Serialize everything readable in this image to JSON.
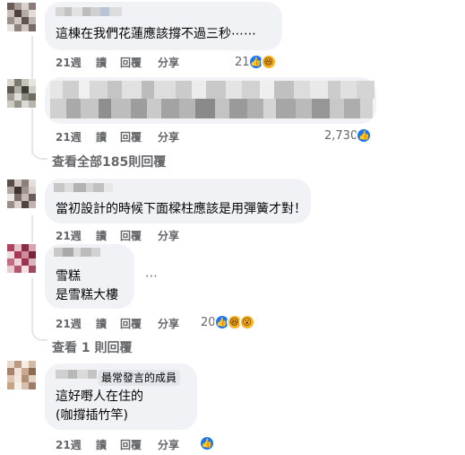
{
  "colors": {
    "like": "#1877f2",
    "laugh": "#f7b125",
    "muted_text": "#65676b",
    "bubble": "#f0f2f5"
  },
  "comments": [
    {
      "text_lines": [
        "這棟在我們花蓮應該撐不過三秒⋯⋯"
      ],
      "time": "21週",
      "read": "讀",
      "reply": "回覆",
      "share": "分享",
      "reaction_count": "21",
      "reaction_icons": [
        "like-icon",
        "laugh-icon"
      ]
    },
    {
      "text_lines": [],
      "time": "21週",
      "read": "讀",
      "reply": "回覆",
      "share": "分享",
      "reaction_count": "2,730",
      "reaction_icons": [
        "like-icon"
      ]
    },
    {
      "text_lines": [
        "當初設計的時候下面樑柱應該是用彈簧才對！"
      ],
      "time": "21週",
      "read": "讀",
      "reply": "回覆",
      "share": "分享",
      "reaction_count": "",
      "reaction_icons": []
    },
    {
      "text_lines": [
        "雪糕",
        "是雪糕大樓"
      ],
      "time": "21週",
      "read": "讀",
      "reply": "回覆",
      "share": "分享",
      "reaction_count": "20",
      "reaction_icons": [
        "like-icon",
        "laugh-icon",
        "wow-icon"
      ],
      "more": "⋯"
    },
    {
      "badge": "最常發言的成員",
      "text_lines": [
        "這好嘢人在住的",
        "(咖撐插竹竿)"
      ],
      "time": "21週",
      "read": "讀",
      "reply": "回覆",
      "share": "分享",
      "reaction_count": "",
      "reaction_icons": [
        "like-icon"
      ]
    }
  ],
  "view_more_1": "查看全部185則回覆",
  "view_more_2": "查看 1 則回覆"
}
